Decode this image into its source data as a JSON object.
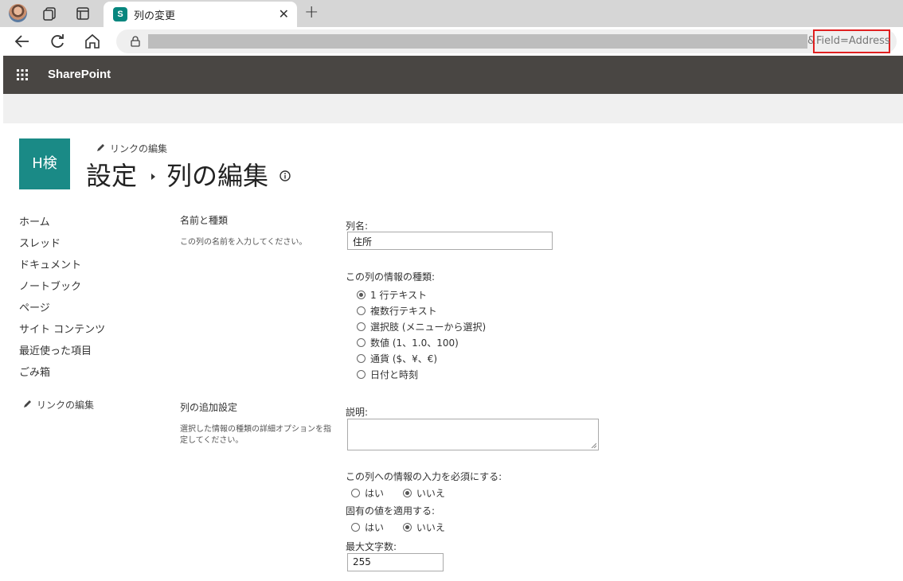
{
  "browser": {
    "tab_title": "列の変更",
    "favicon_letter": "S",
    "url_suffix_amp": "&",
    "url_suffix_field": "Field=Address"
  },
  "suite": {
    "title": "SharePoint"
  },
  "site": {
    "logo_text": "H検",
    "edit_links": "リンクの編集"
  },
  "header": {
    "crumb_parent": "設定",
    "crumb_current": "列の編集"
  },
  "leftnav": {
    "items": [
      "ホーム",
      "スレッド",
      "ドキュメント",
      "ノートブック",
      "ページ",
      "サイト コンテンツ",
      "最近使った項目",
      "ごみ箱"
    ],
    "edit_links": "リンクの編集"
  },
  "section1": {
    "title": "名前と種類",
    "desc": "この列の名前を入力してください。",
    "name_label": "列名:",
    "name_value": "住所",
    "type_label": "この列の情報の種類:",
    "types": [
      "1 行テキスト",
      "複数行テキスト",
      "選択肢 (メニューから選択)",
      "数値 (1、1.0、100)",
      "通貨 ($、¥、€)",
      "日付と時刻"
    ],
    "selected_type": 0
  },
  "section2": {
    "title": "列の追加設定",
    "desc": "選択した情報の種類の詳細オプションを指定してください。",
    "description_label": "説明:",
    "description_value": "",
    "required_label": "この列への情報の入力を必須にする:",
    "unique_label": "固有の値を適用する:",
    "yes": "はい",
    "no": "いいえ",
    "required_selected": "no",
    "unique_selected": "no",
    "maxlen_label": "最大文字数:",
    "maxlen_value": "255"
  }
}
